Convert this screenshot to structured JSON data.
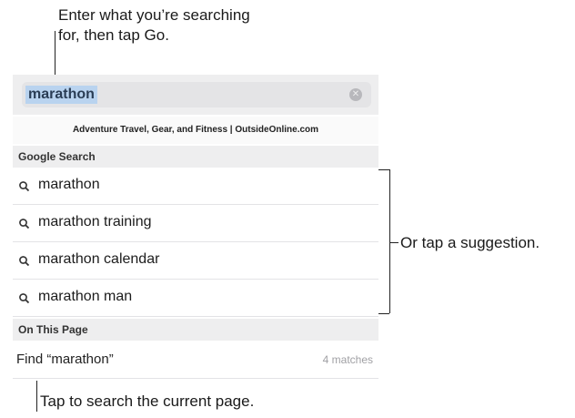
{
  "callouts": {
    "enter_line1": "Enter what you’re searching",
    "enter_line2": "for, then tap Go.",
    "suggestion_tip": "Or tap a suggestion.",
    "page_search_tip": "Tap to search the current page."
  },
  "search": {
    "query": "marathon",
    "clear_icon": "clear-icon"
  },
  "top_hit": {
    "title": "Adventure Travel, Gear, and Fitness | OutsideOnline.com"
  },
  "google_section": {
    "header": "Google Search",
    "suggestions": [
      {
        "label": "marathon",
        "icon": "search-icon"
      },
      {
        "label": "marathon training",
        "icon": "search-icon"
      },
      {
        "label": "marathon calendar",
        "icon": "search-icon"
      },
      {
        "label": "marathon man",
        "icon": "search-icon"
      }
    ]
  },
  "page_section": {
    "header": "On This Page",
    "find_label": "Find “marathon”",
    "match_count": "4 matches"
  }
}
